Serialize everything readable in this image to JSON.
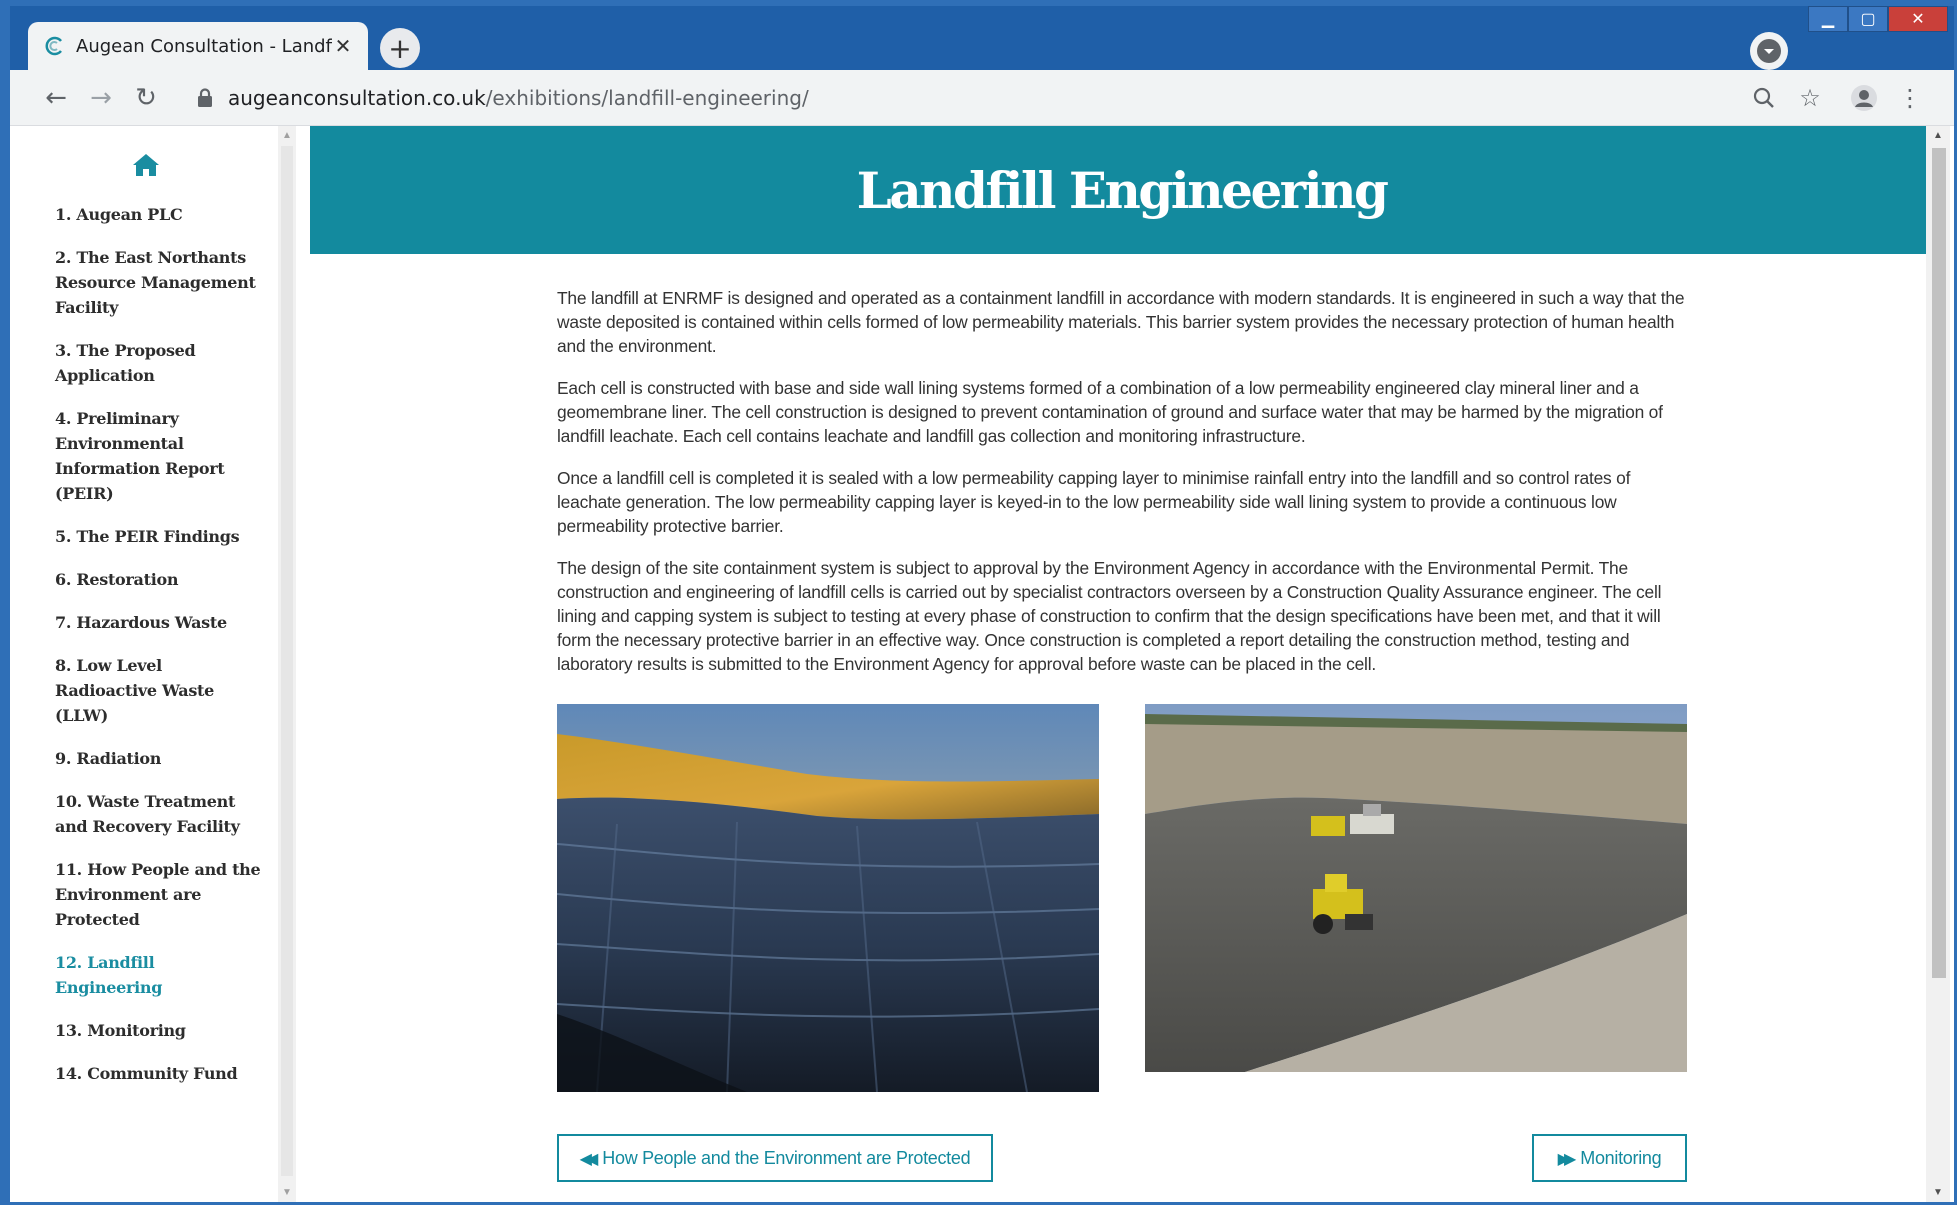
{
  "browser": {
    "tab_title": "Augean Consultation - Landfill Er",
    "url_host": "augeanconsultation.co.uk",
    "url_path": "/exhibitions/landfill-engineering/"
  },
  "sidebar": {
    "items": [
      {
        "label": "1. Augean PLC",
        "active": false
      },
      {
        "label": "2. The East Northants Resource Management Facility",
        "active": false
      },
      {
        "label": "3. The Proposed Application",
        "active": false
      },
      {
        "label": "4. Preliminary Environmental Information Report (PEIR)",
        "active": false
      },
      {
        "label": "5. The PEIR Findings",
        "active": false
      },
      {
        "label": "6. Restoration",
        "active": false
      },
      {
        "label": "7. Hazardous Waste",
        "active": false
      },
      {
        "label": "8. Low Level Radioactive Waste (LLW)",
        "active": false
      },
      {
        "label": "9. Radiation",
        "active": false
      },
      {
        "label": "10. Waste Treatment and Recovery Facility",
        "active": false
      },
      {
        "label": "11. How People and the Environment are Protected",
        "active": false
      },
      {
        "label": "12. Landfill Engineering",
        "active": true
      },
      {
        "label": "13. Monitoring",
        "active": false
      },
      {
        "label": "14. Community Fund",
        "active": false
      }
    ]
  },
  "page": {
    "title": "Landfill Engineering",
    "paragraphs": [
      "The landfill at ENRMF is designed and operated as a containment landfill in accordance with modern standards. It is engineered in such a way that the waste deposited is contained within cells formed of low permeability materials. This barrier system provides the necessary protection of human health and the environment.",
      "Each cell is constructed with base and side wall lining systems formed of a combination of a low permeability engineered clay mineral liner and a geomembrane liner. The cell construction is designed to prevent contamination of ground and surface water that may be harmed by the migration of landfill leachate. Each cell contains leachate and landfill gas collection and monitoring infrastructure.",
      "Once a landfill cell is completed it is sealed with a low permeability capping layer to minimise rainfall entry into the landfill and so control rates of leachate generation. The low permeability capping layer is keyed-in to the low permeability side wall lining system to provide a continuous low permeability protective barrier.",
      "The design of the site containment system is subject to approval by the Environment Agency in accordance with the Environmental Permit. The construction and engineering of landfill cells is carried out by specialist contractors overseen by a Construction Quality Assurance engineer. The cell lining and capping system is subject to testing at every phase of construction to confirm that the design specifications have been met, and that it will form the necessary protective barrier in an effective way. Once construction is completed a report detailing the construction method, testing and laboratory results is submitted to the Environment Agency for approval before waste can be placed in the cell."
    ],
    "prev_label": "How People and the Environment are Protected",
    "next_label": "Monitoring"
  },
  "colors": {
    "accent": "#138a9e",
    "active_nav": "#1a8da1",
    "body_text": "#333333"
  }
}
